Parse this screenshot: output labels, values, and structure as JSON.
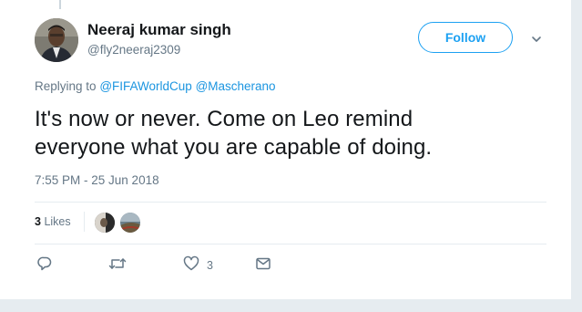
{
  "user": {
    "name": "Neeraj kumar singh",
    "handle": "@fly2neeraj2309"
  },
  "follow_label": "Follow",
  "reply_context": {
    "prefix": "Replying to",
    "mentions": [
      "@FIFAWorldCup",
      "@Mascherano"
    ]
  },
  "tweet": {
    "line1": "It's now or never. Come on Leo remind",
    "line2": "everyone what you are capable of doing.",
    "timestamp": "7:55 PM - 25 Jun 2018"
  },
  "stats": {
    "likes_count": "3",
    "likes_label": "Likes"
  },
  "actions": {
    "like_count": "3"
  },
  "colors": {
    "accent": "#1da1f2",
    "link": "#1b95e0",
    "muted": "#657786",
    "text": "#14171a",
    "divider": "#e6ecf0"
  },
  "icons": [
    "reply-icon",
    "retweet-icon",
    "like-icon",
    "direct-message-icon",
    "chevron-down-icon"
  ]
}
